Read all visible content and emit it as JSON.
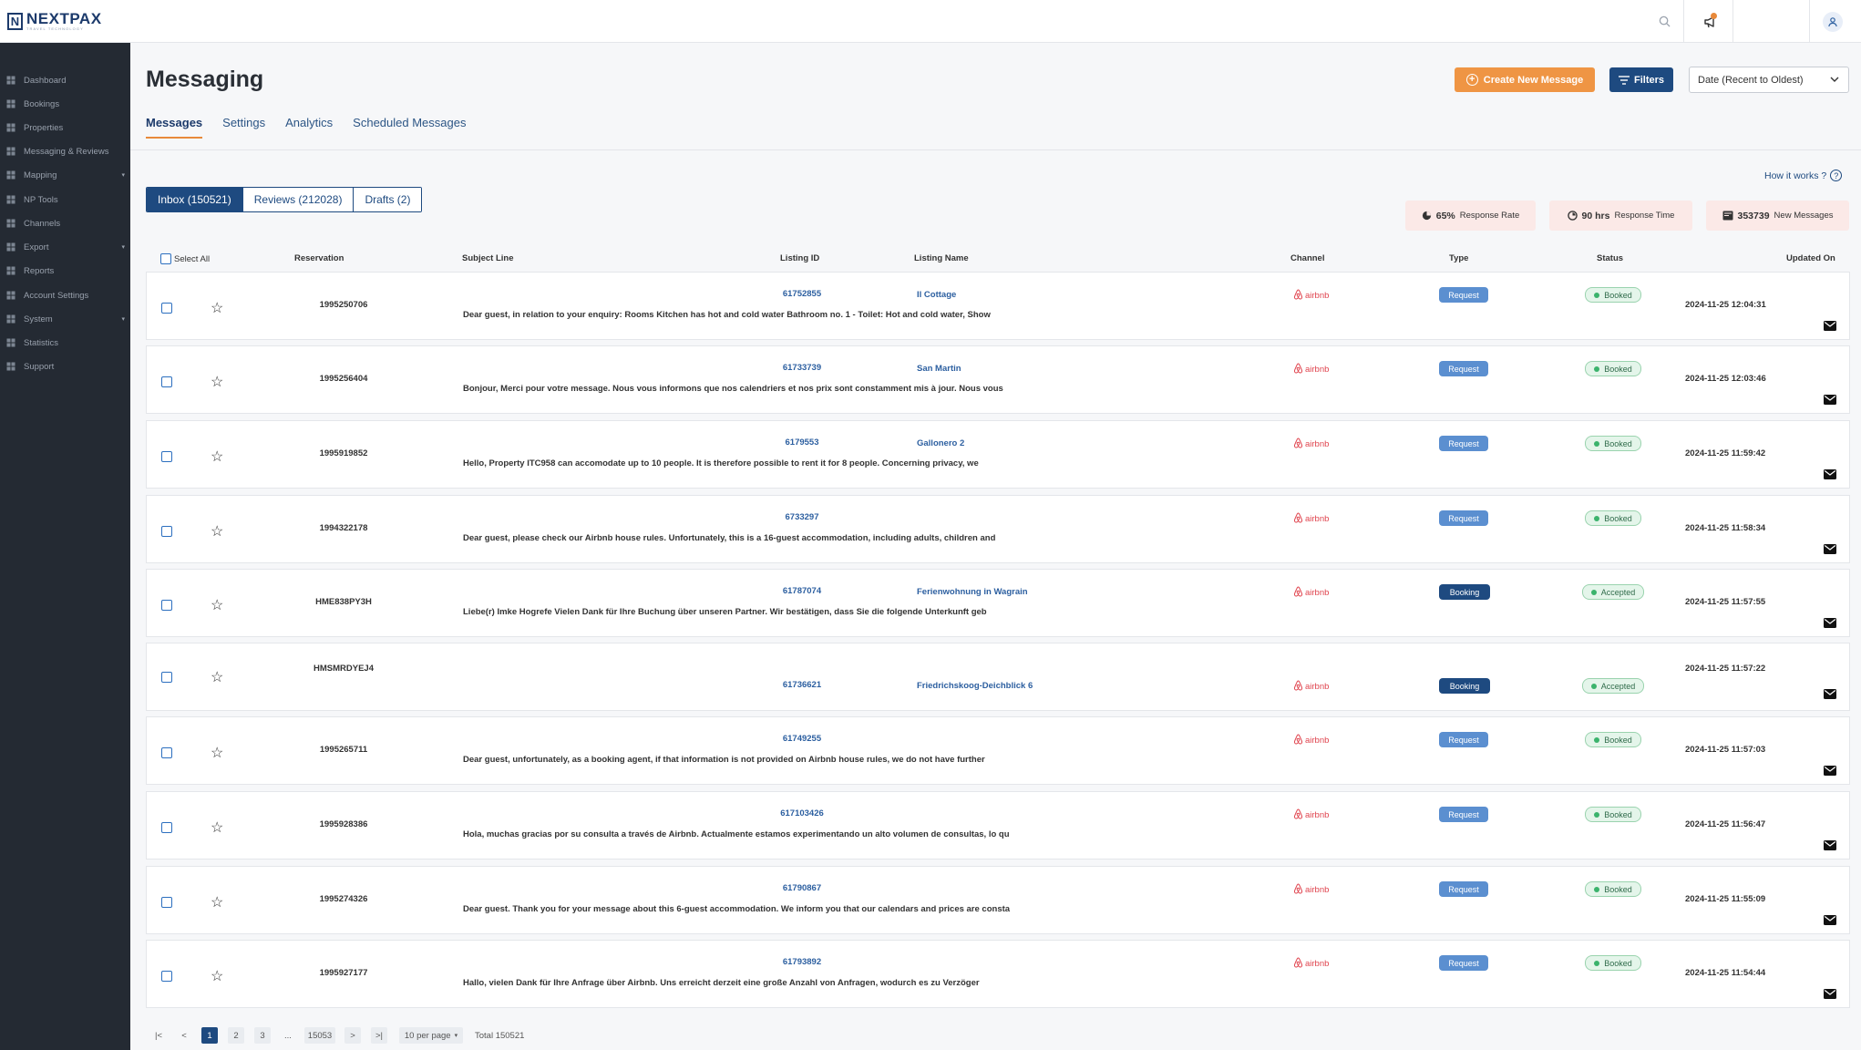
{
  "brand": {
    "name": "NEXTPAX",
    "tagline": "TRAVEL TECHNOLOGY",
    "accent": "#ef9544",
    "primary": "#1e4a80"
  },
  "topbar": {
    "icons": [
      "search-icon",
      "megaphone-icon",
      "user-icon"
    ]
  },
  "sidebar": {
    "items": [
      {
        "label": "Dashboard",
        "icon": "dashboard-icon",
        "expandable": false
      },
      {
        "label": "Bookings",
        "icon": "bookings-icon",
        "expandable": false
      },
      {
        "label": "Properties",
        "icon": "properties-icon",
        "expandable": false
      },
      {
        "label": "Messaging & Reviews",
        "icon": "messaging-icon",
        "expandable": false
      },
      {
        "label": "Mapping",
        "icon": "mapping-icon",
        "expandable": true
      },
      {
        "label": "NP Tools",
        "icon": "tools-icon",
        "expandable": false
      },
      {
        "label": "Channels",
        "icon": "channels-icon",
        "expandable": false
      },
      {
        "label": "Export",
        "icon": "export-icon",
        "expandable": true
      },
      {
        "label": "Reports",
        "icon": "reports-icon",
        "expandable": false
      },
      {
        "label": "Account Settings",
        "icon": "account-settings-icon",
        "expandable": false
      },
      {
        "label": "System",
        "icon": "system-icon",
        "expandable": true
      },
      {
        "label": "Statistics",
        "icon": "statistics-icon",
        "expandable": false
      },
      {
        "label": "Support",
        "icon": "support-icon",
        "expandable": false
      }
    ]
  },
  "page": {
    "title": "Messaging",
    "tabs": [
      "Messages",
      "Settings",
      "Analytics",
      "Scheduled Messages"
    ],
    "create_label": "Create New Message",
    "filters_label": "Filters",
    "sort_value": "Date (Recent to Oldest)"
  },
  "folders": [
    "Inbox (150521)",
    "Reviews (212028)",
    "Drafts (2)"
  ],
  "how_it_works": "How it works ?",
  "stats": [
    {
      "value": "65%",
      "label": "Response Rate",
      "icon": "pie-chart-icon"
    },
    {
      "value": "90 hrs",
      "label": "Response Time",
      "icon": "clock-icon"
    },
    {
      "value": "353739",
      "label": "New Messages",
      "icon": "inbox-icon"
    }
  ],
  "table": {
    "select_all": "Select All",
    "headers": {
      "reservation": "Reservation",
      "subject": "Subject Line",
      "listing_id": "Listing ID",
      "listing_name": "Listing Name",
      "channel": "Channel",
      "type": "Type",
      "status": "Status",
      "updated": "Updated On"
    },
    "type_colors": {
      "Request": "#5b8fd0",
      "Booking": "#1e4a80"
    },
    "rows": [
      {
        "reservation": "1995250706",
        "listing_id": "61752855",
        "listing_name": "Il Cottage",
        "subject": "Dear guest, in relation to your enquiry: Rooms Kitchen has hot and cold water Bathroom no. 1 - Toilet: Hot and cold water, Show",
        "channel": "airbnb",
        "type": "Request",
        "status": "Booked",
        "updated": "2024-11-25 12:04:31"
      },
      {
        "reservation": "1995256404",
        "listing_id": "61733739",
        "listing_name": "San Martin",
        "subject": "Bonjour, Merci pour votre message. Nous vous informons que nos calendriers et nos prix sont constamment mis à jour. Nous vous",
        "channel": "airbnb",
        "type": "Request",
        "status": "Booked",
        "updated": "2024-11-25 12:03:46"
      },
      {
        "reservation": "1995919852",
        "listing_id": "6179553",
        "listing_name": "Gallonero 2",
        "subject": "Hello, Property ITC958 can accomodate up to 10 people. It is therefore possible to rent it for 8 people. Concerning privacy, we",
        "channel": "airbnb",
        "type": "Request",
        "status": "Booked",
        "updated": "2024-11-25 11:59:42"
      },
      {
        "reservation": "1994322178",
        "listing_id": "6733297",
        "listing_name": "",
        "subject": "Dear guest, please check our Airbnb house rules. Unfortunately, this is a 16-guest accommodation, including adults, children and",
        "channel": "airbnb",
        "type": "Request",
        "status": "Booked",
        "updated": "2024-11-25 11:58:34"
      },
      {
        "reservation": "HME838PY3H",
        "listing_id": "61787074",
        "listing_name": "Ferienwohnung in Wagrain",
        "subject": "Liebe(r) Imke Hogrefe Vielen Dank für Ihre Buchung über unseren Partner. Wir bestätigen, dass Sie die folgende Unterkunft geb",
        "channel": "airbnb",
        "type": "Booking",
        "status": "Accepted",
        "updated": "2024-11-25 11:57:55"
      },
      {
        "reservation": "HMSMRDYEJ4",
        "listing_id": "61736621",
        "listing_name": "Friedrichskoog-Deichblick 6",
        "subject": "",
        "channel": "airbnb",
        "type": "Booking",
        "status": "Accepted",
        "updated": "2024-11-25 11:57:22"
      },
      {
        "reservation": "1995265711",
        "listing_id": "61749255",
        "listing_name": "",
        "subject": "Dear guest, unfortunately, as a booking agent, if that information is not provided on Airbnb house rules, we do not have further",
        "channel": "airbnb",
        "type": "Request",
        "status": "Booked",
        "updated": "2024-11-25 11:57:03"
      },
      {
        "reservation": "1995928386",
        "listing_id": "617103426",
        "listing_name": "",
        "subject": "Hola, muchas gracias por su consulta a través de Airbnb. Actualmente estamos experimentando un alto volumen de consultas, lo qu",
        "channel": "airbnb",
        "type": "Request",
        "status": "Booked",
        "updated": "2024-11-25 11:56:47"
      },
      {
        "reservation": "1995274326",
        "listing_id": "61790867",
        "listing_name": "",
        "subject": "Dear guest. Thank you for your message about this 6-guest accommodation. We inform you that our calendars and prices are consta",
        "channel": "airbnb",
        "type": "Request",
        "status": "Booked",
        "updated": "2024-11-25 11:55:09"
      },
      {
        "reservation": "1995927177",
        "listing_id": "61793892",
        "listing_name": "",
        "subject": "Hallo, vielen Dank für Ihre Anfrage über Airbnb. Uns erreicht derzeit eine große Anzahl von Anfragen, wodurch es zu Verzöger",
        "channel": "airbnb",
        "type": "Request",
        "status": "Booked",
        "updated": "2024-11-25 11:54:44"
      }
    ]
  },
  "pagination": {
    "first": "|<",
    "prev": "<",
    "next": ">",
    "last": ">|",
    "pages": [
      "1",
      "2",
      "3"
    ],
    "ellipsis": "...",
    "last_page": "15053",
    "per_page": "10 per page",
    "total": "Total 150521"
  }
}
